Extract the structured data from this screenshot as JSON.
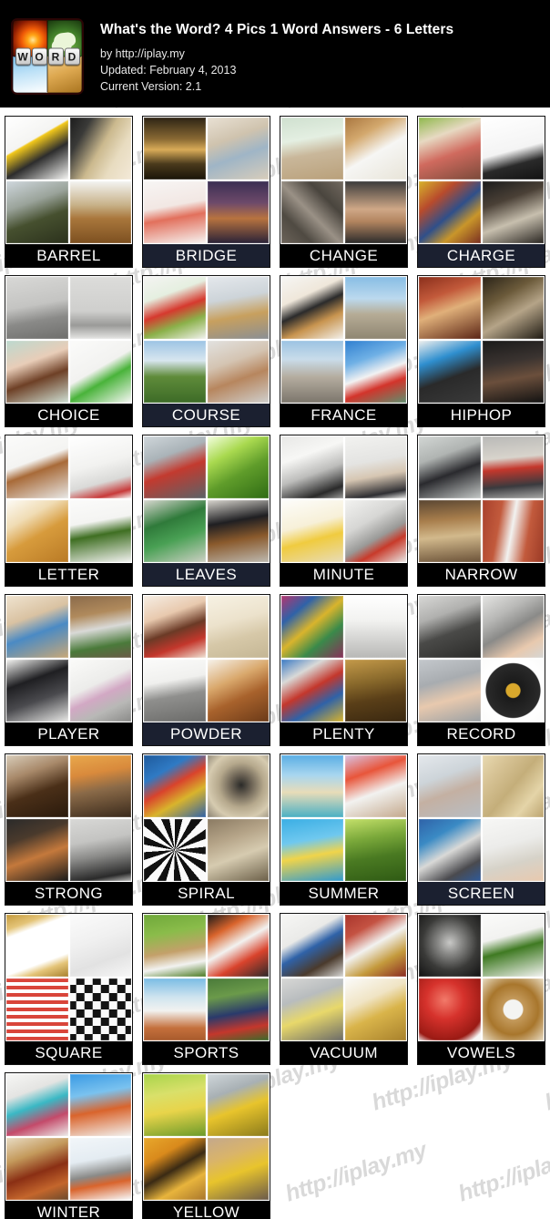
{
  "header": {
    "logo": {
      "name": "4-pics-1-word-logo",
      "letters": [
        "W",
        "O",
        "R",
        "D"
      ],
      "quadrants": [
        "fire",
        "dog",
        "sky",
        "sand"
      ]
    },
    "title": "What's the Word? 4 Pics 1 Word  Answers - 6 Letters",
    "byline": "by http://iplay.my",
    "updated": "Updated: February 4, 2013",
    "version": "Current Version: 2.1",
    "background_color": "#000000",
    "text_color": "#ffffff"
  },
  "watermark": {
    "text": "http://iplay.my",
    "color": "#d9d9d9"
  },
  "answers": [
    {
      "word": "BARREL",
      "label_style": "black",
      "pics": [
        "oil-drum-yellow",
        "gun-barrel-pointing",
        "hunter-with-rifle",
        "kitten-in-wooden-barrel"
      ]
    },
    {
      "word": "BRIDGE",
      "label_style": "navy",
      "pics": [
        "stone-bridge-reflection-autumn",
        "elderly-couple-playing-cards",
        "dental-bridge-teeth-model",
        "illuminated-city-bridge-at-dusk"
      ]
    },
    {
      "word": "CHANGE",
      "label_style": "black",
      "pics": [
        "one-dollar-bill-with-coin-stacks",
        "coffee-cup-with-tip-money",
        "crossing-railway-tracks",
        "before-after-weight-loss-man"
      ]
    },
    {
      "word": "CHARGE",
      "label_style": "navy",
      "pics": [
        "women-shopping-with-credit-card",
        "black-power-adapter-plug",
        "assorted-batteries",
        "business-meeting-with-documents"
      ]
    },
    {
      "word": "CHOICE",
      "label_style": "black",
      "pics": [
        "man-thinking-with-drawn-thought-bubbles",
        "man-facing-arrows-in-three-directions",
        "woman-choosing-apple-or-cake",
        "green-marker-ticking-checkbox"
      ]
    },
    {
      "word": "COURSE",
      "label_style": "navy",
      "pics": [
        "gourmet-plated-dessert",
        "lecturer-teaching-classroom",
        "golfer-swinging-on-fairway",
        "students-at-computers"
      ]
    },
    {
      "word": "FRANCE",
      "label_style": "black",
      "pics": [
        "dog-with-beret-wine-and-baguette",
        "eiffel-tower-paris-skyline",
        "arc-de-triomphe",
        "statue-holding-french-flag"
      ]
    },
    {
      "word": "HIPHOP",
      "label_style": "black",
      "pics": [
        "female-rapper-with-microphone",
        "hooded-youth-with-graffiti",
        "boy-carrying-boombox",
        "rapper-with-crossed-arms"
      ]
    },
    {
      "word": "LETTER",
      "label_style": "black",
      "pics": [
        "dog-holding-airmail-envelope",
        "open-white-envelope",
        "alphabet-cookie-letters",
        "grass-letter-y"
      ]
    },
    {
      "word": "LEAVES",
      "label_style": "navy",
      "pics": [
        "train-departing-station-with-clock",
        "green-leaves-backlit",
        "man-exiting-through-green-door",
        "people-sitting-with-suitcases"
      ]
    },
    {
      "word": "MINUTE",
      "label_style": "black",
      "pics": [
        "man-pushing-clock-hands",
        "man-holding-tiny-businessman",
        "chick-hatching-from-egg",
        "stopwatch-showing-60"
      ]
    },
    {
      "word": "NARROW",
      "label_style": "black",
      "pics": [
        "man-squeezed-into-small-space",
        "slim-waist-with-red-belt",
        "narrow-alley-between-buildings",
        "narrow-white-door-in-brick-wall"
      ]
    },
    {
      "word": "PLAYER",
      "label_style": "black",
      "pics": [
        "children-playing-board-game",
        "baseball-batter-running",
        "couple-flirting-at-party",
        "cd-disc-in-player-tray"
      ]
    },
    {
      "word": "POWDER",
      "label_style": "navy",
      "pics": [
        "woman-applying-makeup-brush",
        "scoop-of-milk-powder",
        "pile-of-grey-powder",
        "cinnamon-sticks-and-ground-spice"
      ]
    },
    {
      "word": "PLENTY",
      "label_style": "black",
      "pics": [
        "magazine-rack-full-of-magazines",
        "long-chain-necklace",
        "many-national-flags",
        "crowd-with-raised-hands"
      ]
    },
    {
      "word": "RECORD",
      "label_style": "black",
      "pics": [
        "turntable-stylus-on-vinyl",
        "hand-holding-microphone",
        "hand-holding-stopwatch",
        "black-vinyl-record"
      ]
    },
    {
      "word": "STRONG",
      "label_style": "black",
      "pics": [
        "coffee-beans-and-espresso-cup",
        "ant-lifting-log",
        "muscular-bodybuilder-back",
        "boy-lifting-dumbbell"
      ]
    },
    {
      "word": "SPIRAL",
      "label_style": "black",
      "pics": [
        "dna-double-helix",
        "spiral-staircase-looking-down",
        "black-white-spiral-optical-illusion",
        "spiral-carved-stone-ruins"
      ]
    },
    {
      "word": "SUMMER",
      "label_style": "black",
      "pics": [
        "tropical-beach-with-palm-tree",
        "dog-with-sunglasses-and-umbrella",
        "woman-on-pool-float",
        "sunlit-bamboo-forest"
      ]
    },
    {
      "word": "SCREEN",
      "label_style": "navy",
      "pics": [
        "woman-at-desk-with-monitor",
        "folding-room-divider-screen",
        "tv-display-wall-in-store",
        "hands-sieving-flour"
      ]
    },
    {
      "word": "SQUARE",
      "label_style": "black",
      "pics": [
        "gold-picture-frame",
        "white-window-grid-pane",
        "red-checkered-gingham-cloth",
        "black-white-checkered-flag"
      ]
    },
    {
      "word": "SPORTS",
      "label_style": "black",
      "pics": [
        "baseball-bat-and-ball-on-grass",
        "assorted-sports-balls",
        "woman-playing-tennis",
        "football-players-on-field"
      ]
    },
    {
      "word": "VACUUM",
      "label_style": "black",
      "pics": [
        "vacuum-cleaner-head-on-floor",
        "pressure-gauges-on-red-tank",
        "woman-vacuuming-car-seat",
        "opened-sardine-tin-can"
      ]
    },
    {
      "word": "VOWELS",
      "label_style": "black",
      "pics": [
        "metal-gear-letter-a",
        "grass-letter-e",
        "red-glossy-letter-i",
        "wooden-letter-o"
      ]
    },
    {
      "word": "WINTER",
      "label_style": "black",
      "pics": [
        "girl-in-knit-hat-blowing-nose",
        "family-sledding-in-snow",
        "glass-of-hot-tea-with-spices",
        "snowman-in-snow"
      ]
    },
    {
      "word": "YELLOW",
      "label_style": "black",
      "pics": [
        "woman-in-field-of-yellow-flowers",
        "worker-in-yellow-rain-jacket",
        "bees-on-honeycomb",
        "woman-beside-yellow-vintage-car"
      ]
    }
  ],
  "layout": {
    "columns": 4,
    "total_answers": 26,
    "letter_count": 6
  }
}
